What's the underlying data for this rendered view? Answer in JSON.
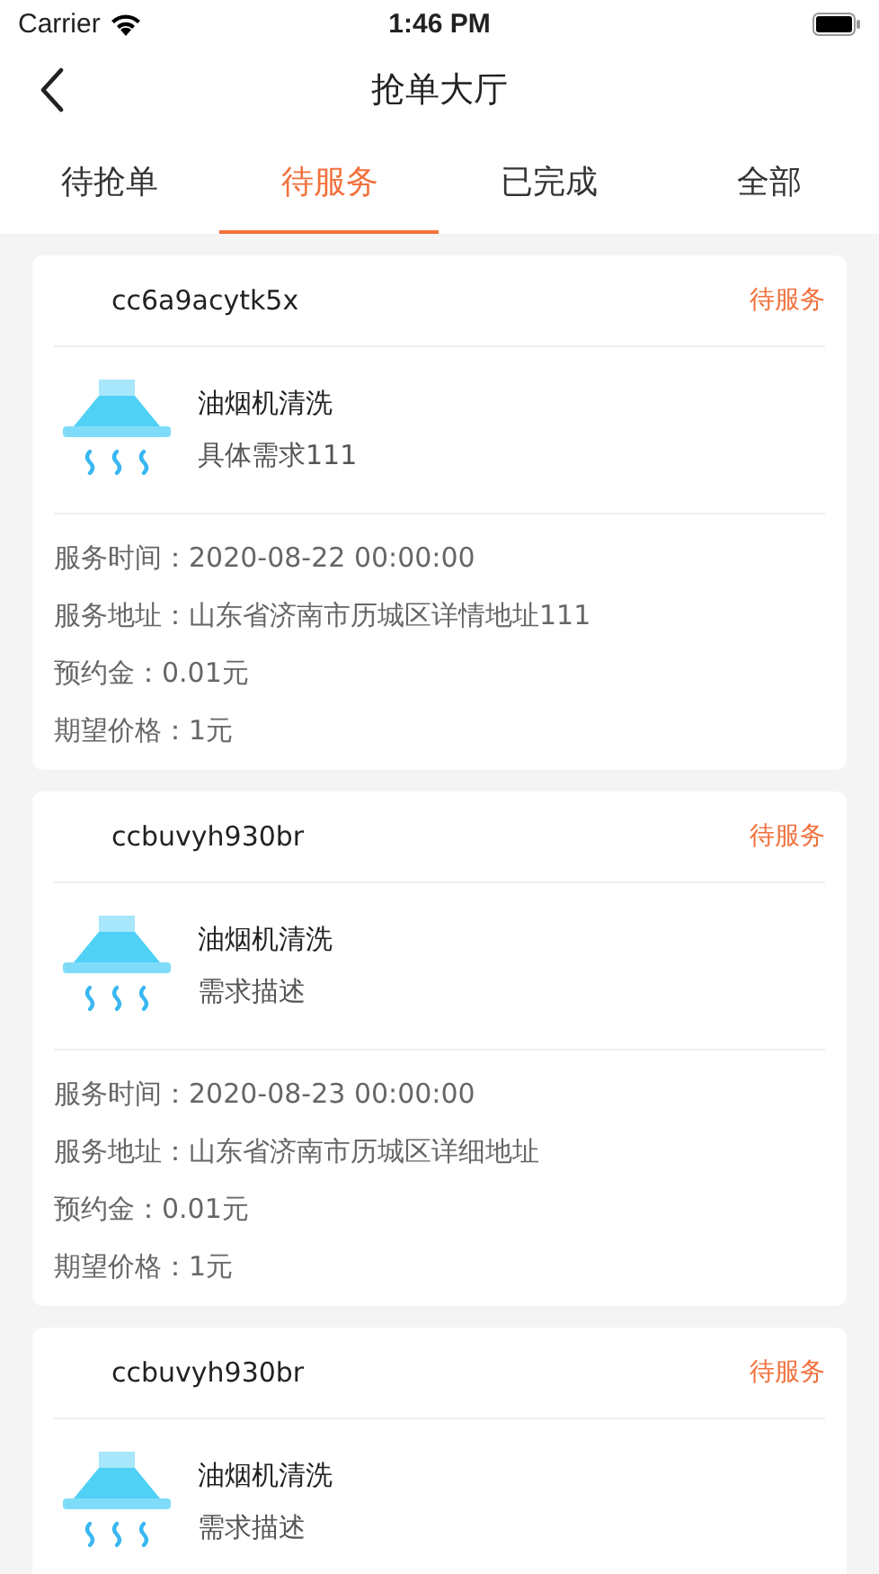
{
  "status_bar": {
    "carrier": "Carrier",
    "time": "1:46 PM"
  },
  "nav": {
    "title": "抢单大厅"
  },
  "tabs": [
    {
      "label": "待抢单",
      "selected": false
    },
    {
      "label": "待服务",
      "selected": true
    },
    {
      "label": "已完成",
      "selected": false
    },
    {
      "label": "全部",
      "selected": false
    }
  ],
  "orders": [
    {
      "order_no": "cc6a9acytk5x",
      "status": "待服务",
      "service": "油烟机清洗",
      "description": "具体需求111",
      "details": [
        "服务时间：2020-08-22 00:00:00",
        "服务地址：山东省济南市历城区详情地址111",
        "预约金：0.01元",
        "期望价格：1元"
      ]
    },
    {
      "order_no": "ccbuvyh930br",
      "status": "待服务",
      "service": "油烟机清洗",
      "description": "需求描述",
      "details": [
        "服务时间：2020-08-23 00:00:00",
        "服务地址：山东省济南市历城区详细地址",
        "预约金：0.01元",
        "期望价格：1元"
      ]
    },
    {
      "order_no": "ccbuvyh930br",
      "status": "待服务",
      "service": "油烟机清洗",
      "description": "需求描述"
    }
  ]
}
